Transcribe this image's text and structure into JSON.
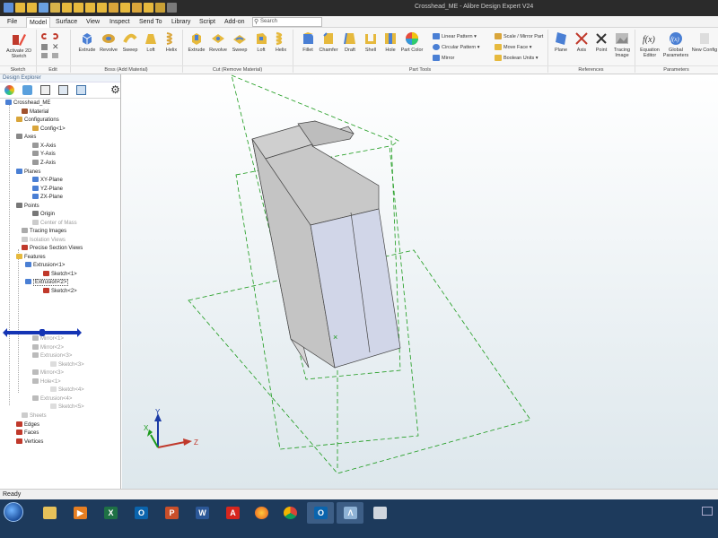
{
  "app": {
    "window_title": "Crosshead_ME - Alibre Design Expert V24",
    "status": "Ready"
  },
  "menu": {
    "tabs": [
      "File",
      "Model",
      "Surface",
      "View",
      "Inspect",
      "Send To",
      "Library",
      "Script",
      "Add-on"
    ],
    "active": "Model",
    "search_placeholder": "Search"
  },
  "ribbon": {
    "sketch": {
      "label": "Activate 2D Sketch"
    },
    "add_material": [
      "Extrude",
      "Revolve",
      "Sweep",
      "Loft",
      "Helix"
    ],
    "remove_material": [
      "Extrude",
      "Revolve",
      "Sweep",
      "Loft",
      "Helix"
    ],
    "part_tools": [
      "Fillet",
      "Chamfer",
      "Draft",
      "Shell",
      "Hole",
      "Part Color"
    ],
    "pattern_tools": [
      "Linear Pattern",
      "Circular Pattern",
      "Mirror"
    ],
    "face_tools": [
      "Scale / Mirror Part",
      "Move Face",
      "Boolean Units"
    ],
    "references": [
      "Plane",
      "Axis",
      "Point",
      "Tracing Image"
    ],
    "parameters": [
      "Equation Editor",
      "Global Parameters",
      "New Config"
    ],
    "groups": {
      "sketch": "Sketch",
      "edit": "Edit",
      "add": "Boss (Add Material)",
      "cut": "Cut (Remove Material)",
      "part": "Part Tools",
      "refs": "References",
      "params": "Parameters"
    }
  },
  "explorer": {
    "title": "Design Explorer",
    "tree": [
      {
        "label": "Crosshead_ME",
        "dim": false
      },
      {
        "label": "Material",
        "dim": false
      },
      {
        "label": "Configurations",
        "dim": false
      },
      {
        "label": "Config<1>",
        "dim": false
      },
      {
        "label": "Axes",
        "dim": false
      },
      {
        "label": "X-Axis",
        "dim": false
      },
      {
        "label": "Y-Axis",
        "dim": false
      },
      {
        "label": "Z-Axis",
        "dim": false
      },
      {
        "label": "Planes",
        "dim": false
      },
      {
        "label": "XY-Plane",
        "dim": false
      },
      {
        "label": "YZ-Plane",
        "dim": false
      },
      {
        "label": "ZX-Plane",
        "dim": false
      },
      {
        "label": "Points",
        "dim": false
      },
      {
        "label": "Origin",
        "dim": false
      },
      {
        "label": "Center of Mass",
        "dim": true
      },
      {
        "label": "Tracing Images",
        "dim": false
      },
      {
        "label": "Isolation Views",
        "dim": true
      },
      {
        "label": "Precise Section Views",
        "dim": false
      },
      {
        "label": "Features",
        "dim": false
      },
      {
        "label": "Extrusion<1>",
        "dim": false
      },
      {
        "label": "Sketch<1>",
        "dim": false
      },
      {
        "label": "Extrusion<2>",
        "dim": false
      },
      {
        "label": "Sketch<2>",
        "dim": false
      },
      {
        "label": "Mirror<1>",
        "dim": true
      },
      {
        "label": "Mirror<2>",
        "dim": true
      },
      {
        "label": "Extrusion<3>",
        "dim": true
      },
      {
        "label": "Sketch<3>",
        "dim": true
      },
      {
        "label": "Mirror<3>",
        "dim": true
      },
      {
        "label": "Hole<1>",
        "dim": true
      },
      {
        "label": "Sketch<4>",
        "dim": true
      },
      {
        "label": "Extrusion<4>",
        "dim": true
      },
      {
        "label": "Sketch<5>",
        "dim": true
      },
      {
        "label": "Sheets",
        "dim": true
      },
      {
        "label": "Edges",
        "dim": false
      },
      {
        "label": "Faces",
        "dim": false
      },
      {
        "label": "Vertices",
        "dim": false
      }
    ]
  },
  "triad": {
    "x": "X",
    "y": "Y",
    "z": "Z"
  },
  "colors": {
    "model_face_light": "#d1d6e8",
    "model_face_dark": "#cfcfcf",
    "plane_green": "#1a9a1a",
    "taskbar": "#1d3a5c"
  },
  "taskbar_apps": [
    "explorer",
    "media",
    "excel",
    "outlook",
    "powerpoint",
    "word",
    "acrobat",
    "firefox",
    "chrome",
    "outlook-2",
    "alibre",
    "alibre-2"
  ]
}
